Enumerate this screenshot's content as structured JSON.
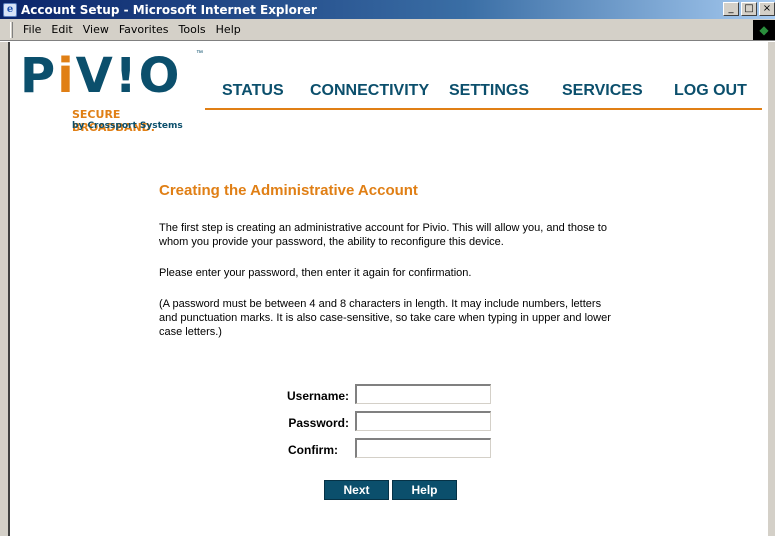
{
  "window": {
    "title": "Account Setup - Microsoft Internet Explorer",
    "controls": [
      "_",
      "□",
      "×"
    ]
  },
  "menubar": {
    "items": [
      "File",
      "Edit",
      "View",
      "Favorites",
      "Tools",
      "Help"
    ]
  },
  "logo": {
    "brand_pre": "P",
    "brand_i": "i",
    "brand_post": "V!O",
    "tm": "™",
    "tagline": "SECURE BROADBAND.",
    "byline": "by Crossport Systems"
  },
  "nav": {
    "items": [
      "STATUS",
      "CONNECTIVITY",
      "SETTINGS",
      "SERVICES",
      "LOG OUT"
    ]
  },
  "page": {
    "heading": "Creating the Administrative Account",
    "para1": "The first step is creating an administrative account for Pivio. This will allow you, and those to whom you provide your password, the ability to reconfigure this device.",
    "para2": "Please enter your password, then enter it again for confirmation.",
    "para3": "(A password must be between 4 and 8 characters in length. It may include numbers, letters and punctuation marks. It is also case-sensitive, so take care when typing in upper and lower case letters.)"
  },
  "form": {
    "username_label": "Username:",
    "password_label": "Password:",
    "confirm_label": "Confirm:",
    "username_value": "",
    "password_value": "",
    "confirm_value": ""
  },
  "buttons": {
    "next": "Next",
    "help": "Help"
  },
  "colors": {
    "brand_blue": "#0b4f6c",
    "brand_orange": "#e07f15"
  }
}
